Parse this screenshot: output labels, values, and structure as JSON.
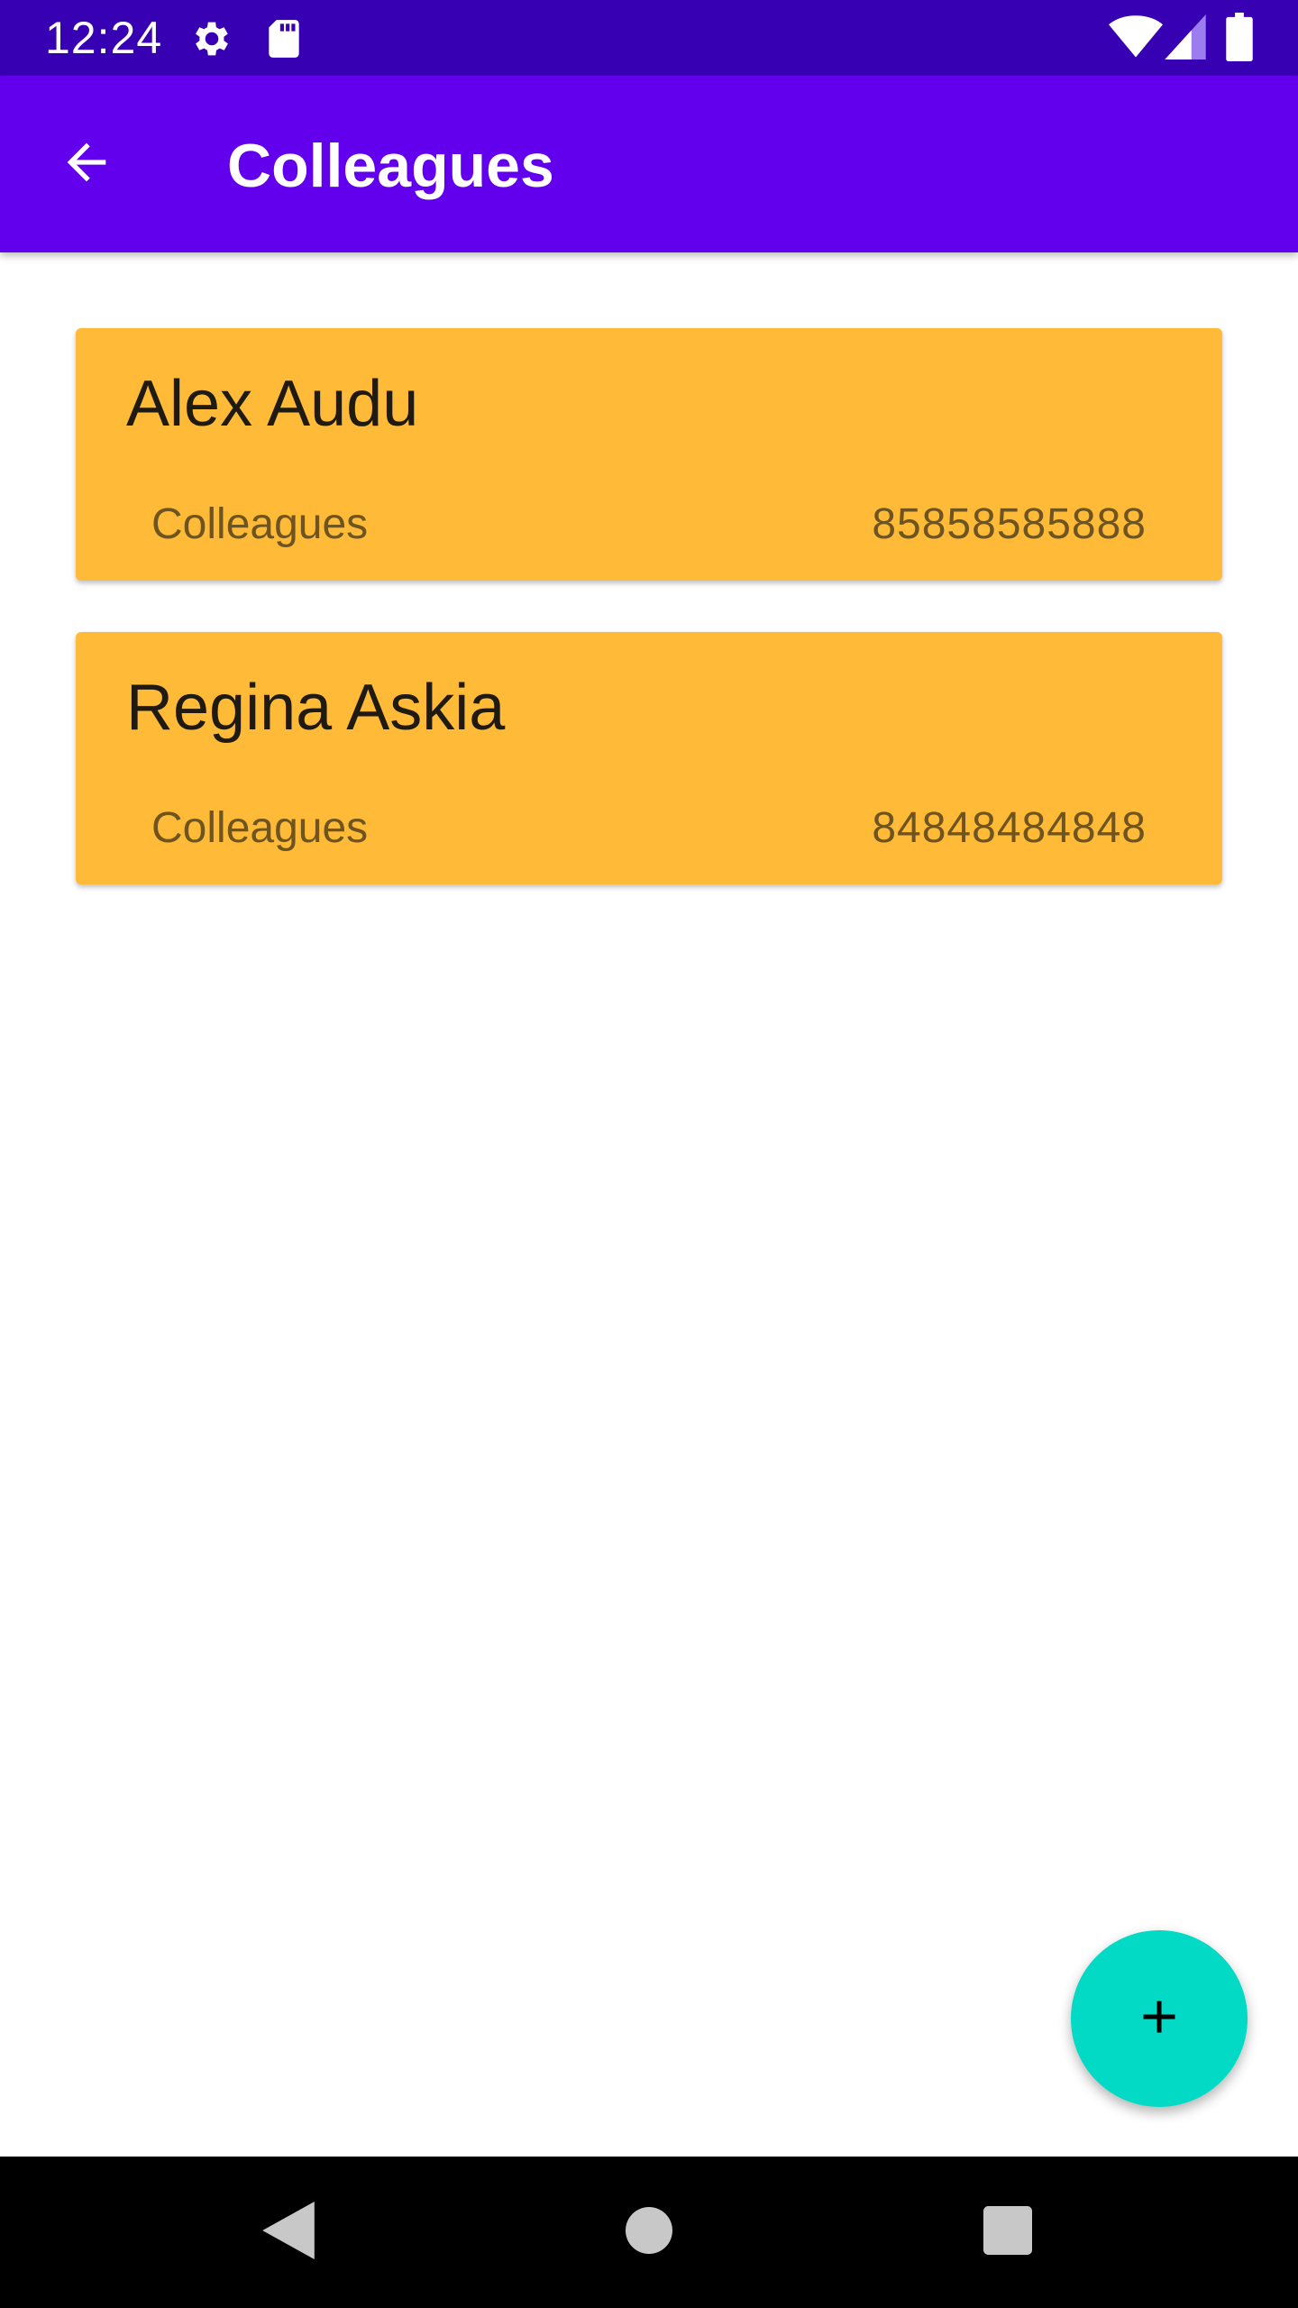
{
  "status_bar": {
    "time": "12:24",
    "icons": [
      "gear-icon",
      "sd-card-icon",
      "wifi-icon",
      "signal-icon",
      "battery-icon"
    ]
  },
  "app_bar": {
    "title": "Colleagues",
    "back_icon": "arrow-back-icon"
  },
  "contacts": [
    {
      "name": "Alex Audu",
      "group": "Colleagues",
      "phone": "85858585888"
    },
    {
      "name": "Regina Askia",
      "group": "Colleagues",
      "phone": "84848484848"
    }
  ],
  "fab": {
    "icon": "plus-icon"
  },
  "nav_bar": {
    "icons": [
      "nav-back-icon",
      "nav-home-icon",
      "nav-recents-icon"
    ]
  },
  "colors": {
    "status_bar": "#3700b3",
    "app_bar": "#6200ee",
    "card": "#ffba37",
    "fab": "#03dac5"
  }
}
